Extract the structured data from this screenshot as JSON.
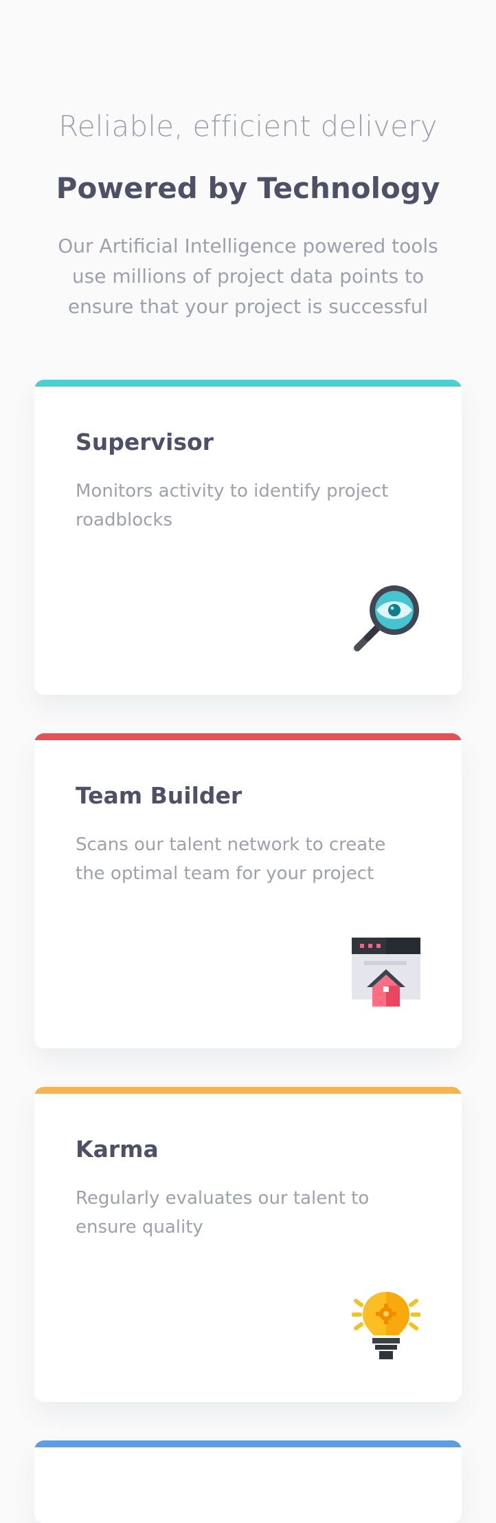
{
  "hero": {
    "kicker": "Reliable, efficient delivery",
    "title": "Powered by Technology",
    "subtitle": "Our Artificial Intelligence powered tools use millions of project data points to ensure that your project is successful"
  },
  "cards": [
    {
      "title": "Supervisor",
      "description": "Monitors activity to identify project roadblocks",
      "accent": "#47d1d1",
      "icon": "magnifier-eye-icon"
    },
    {
      "title": "Team Builder",
      "description": "Scans our talent network to create the optimal team for your project",
      "accent": "#e35353",
      "icon": "browser-house-icon"
    },
    {
      "title": "Karma",
      "description": "Regularly evaluates our talent to ensure quality",
      "accent": "#f9b24c",
      "icon": "lightbulb-gear-icon"
    },
    {
      "title": "",
      "description": "",
      "accent": "#5c9ee6",
      "icon": ""
    }
  ]
}
